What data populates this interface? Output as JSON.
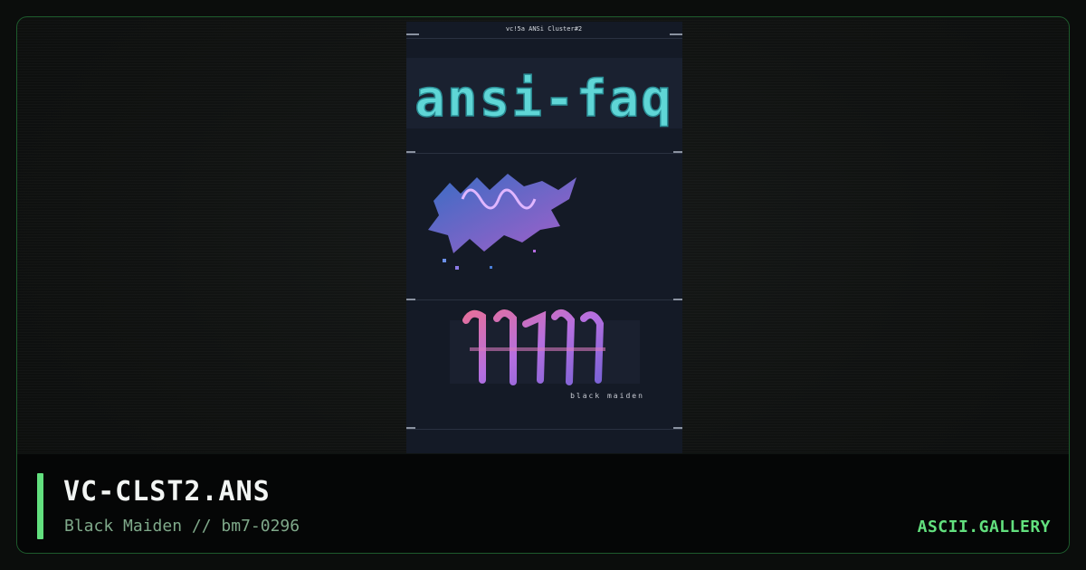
{
  "card": {
    "border_color": "#1d5a2c",
    "accent_color": "#62e07e"
  },
  "artwork": {
    "header_text": "vc!5a ANSi Cluster#2",
    "logo_text": "ansi-faq",
    "credit_text": "black maiden",
    "colors": {
      "background": "#141a26",
      "logo": "#5fd6d6",
      "splash_blue": "#4a7fd8",
      "splash_purple": "#b46be0",
      "pink": "#e87aa8"
    }
  },
  "info": {
    "title": "VC-CLST2.ANS",
    "meta": "Black Maiden // bm7-0296",
    "brand": "ASCII.GALLERY"
  }
}
